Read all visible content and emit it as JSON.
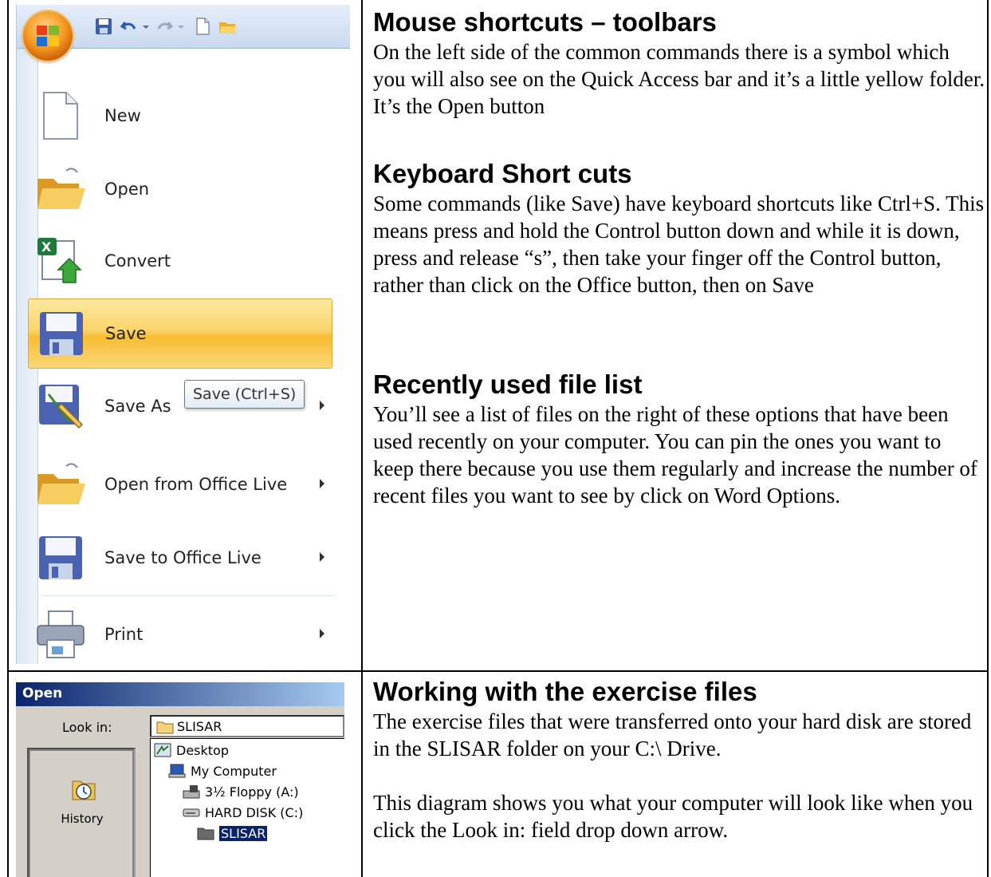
{
  "office_menu": {
    "qat_icons": [
      "save-icon",
      "undo-icon",
      "redo-icon",
      "new-document-icon",
      "open-folder-icon"
    ],
    "items": [
      {
        "label": "New",
        "icon": "new-document-icon",
        "submenu": false
      },
      {
        "label": "Open",
        "icon": "open-folder-icon",
        "submenu": false
      },
      {
        "label": "Convert",
        "icon": "convert-icon",
        "submenu": false
      },
      {
        "label": "Save",
        "icon": "save-icon",
        "submenu": false,
        "highlighted": true
      },
      {
        "label": "Save As",
        "icon": "save-as-icon",
        "submenu": true
      },
      {
        "label": "Open from Office Live",
        "icon": "open-folder-icon",
        "submenu": true
      },
      {
        "label": "Save to Office Live",
        "icon": "save-icon",
        "submenu": true
      },
      {
        "label": "Print",
        "icon": "printer-icon",
        "submenu": true
      }
    ],
    "tooltip": "Save (Ctrl+S)"
  },
  "sections": [
    {
      "heading": "Mouse shortcuts – toolbars",
      "body": "On the left side of the common commands there is a symbol which you will also see on the Quick Access bar and it’s a little yellow folder. It’s the Open button"
    },
    {
      "heading": "Keyboard Short cuts",
      "body": "Some commands (like Save) have keyboard shortcuts like Ctrl+S. This means press and hold the Control button down and while it is down, press and release “s”, then take your finger off the Control button, rather than click on the Office button, then on Save"
    },
    {
      "heading": "Recently used file list",
      "body": "You’ll see a list of files on the right of these options that have been used recently on your computer. You can pin the ones you want to keep there because you use them regularly and increase the number of recent files you want to see by click on Word Options."
    },
    {
      "heading": "Working with the exercise files",
      "body": "The exercise files that were transferred onto your hard disk are stored in the SLISAR folder on your C:\\ Drive.",
      "body2": "This diagram shows you what your computer will look like when you click the Look in: field drop down arrow."
    }
  ],
  "open_dialog": {
    "title": "Open",
    "look_in_label": "Look in:",
    "look_in_value": "SLISAR",
    "places": [
      {
        "label": "History",
        "icon": "history-icon"
      }
    ],
    "tree": [
      {
        "label": "Desktop",
        "icon": "desktop-icon"
      },
      {
        "label": "My Computer",
        "icon": "computer-icon"
      },
      {
        "label": "3½ Floppy (A:)",
        "icon": "floppy-icon"
      },
      {
        "label": "HARD DISK (C:)",
        "icon": "hard-disk-icon"
      },
      {
        "label": "SLISAR",
        "icon": "folder-icon",
        "selected": true
      }
    ]
  }
}
